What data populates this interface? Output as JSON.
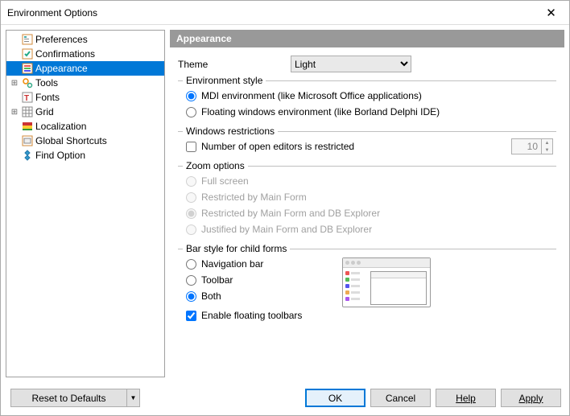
{
  "window": {
    "title": "Environment Options"
  },
  "tree": {
    "items": [
      {
        "label": "Preferences",
        "icon": "pref"
      },
      {
        "label": "Confirmations",
        "icon": "confirm"
      },
      {
        "label": "Appearance",
        "icon": "appearance",
        "selected": true
      },
      {
        "label": "Tools",
        "icon": "tools",
        "expandable": true
      },
      {
        "label": "Fonts",
        "icon": "fonts"
      },
      {
        "label": "Grid",
        "icon": "grid",
        "expandable": true
      },
      {
        "label": "Localization",
        "icon": "local"
      },
      {
        "label": "Global Shortcuts",
        "icon": "shortcuts"
      },
      {
        "label": "Find Option",
        "icon": "find"
      }
    ]
  },
  "panel": {
    "title": "Appearance",
    "theme_label": "Theme",
    "theme_value": "Light",
    "env_style": {
      "legend": "Environment style",
      "mdi": "MDI environment (like Microsoft Office applications)",
      "floating": "Floating windows environment (like Borland Delphi IDE)"
    },
    "restrictions": {
      "legend": "Windows restrictions",
      "num_restricted": "Number of open editors is restricted",
      "num_value": "10"
    },
    "zoom": {
      "legend": "Zoom options",
      "full": "Full screen",
      "by_main": "Restricted by Main Form",
      "by_main_db": "Restricted by Main Form and DB Explorer",
      "justified": "Justified by Main Form and DB Explorer"
    },
    "barstyle": {
      "legend": "Bar style for child forms",
      "nav": "Navigation bar",
      "toolbar": "Toolbar",
      "both": "Both",
      "floating_tb": "Enable floating toolbars"
    }
  },
  "footer": {
    "reset": "Reset to Defaults",
    "ok": "OK",
    "cancel": "Cancel",
    "help": "Help",
    "apply": "Apply"
  }
}
